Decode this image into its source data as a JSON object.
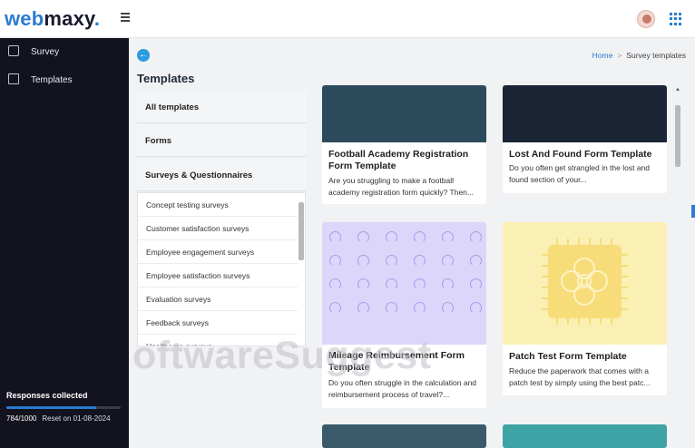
{
  "brand": {
    "web": "web",
    "maxy": "maxy",
    "dot": "."
  },
  "sidebar": {
    "items": [
      {
        "label": "Survey",
        "icon": "survey-icon"
      },
      {
        "label": "Templates",
        "icon": "templates-icon"
      }
    ],
    "responses": {
      "title": "Responses collected",
      "count": "784/1000",
      "reset": "Reset on 01-08-2024",
      "progress": 0.784
    }
  },
  "header": {
    "menu_icon": "hamburger-icon",
    "apps_icon": "grid-apps-icon",
    "avatar": "user-avatar"
  },
  "main": {
    "title": "Templates",
    "breadcrumb": {
      "home": "Home",
      "separator": ">",
      "current": "Survey templates"
    }
  },
  "categories": {
    "heads": [
      "All templates",
      "Forms",
      "Surveys & Questionnaires"
    ],
    "items": [
      "Concept testing surveys",
      "Customer satisfaction surveys",
      "Employee engagement surveys",
      "Employee satisfaction surveys",
      "Evaluation surveys",
      "Feedback surveys",
      "Healthcare surveys"
    ]
  },
  "cards": [
    {
      "title": "Football Academy Registration Form Template",
      "desc": "Are you struggling to make a football academy registration form quickly? Then...",
      "color": "#2c4a5c"
    },
    {
      "title": "Lost And Found Form Template",
      "desc": "Do you often get strangled in the lost and found section of your...",
      "color": "#1b2535"
    },
    {
      "title": "Mileage Reimbursement Form Template",
      "desc": "Do you often struggle in the calculation and reimbursement process of travel?...",
      "color": "#dcd6fb"
    },
    {
      "title": "Patch Test Form Template",
      "desc": "Reduce the paperwork that comes with a patch test by simply using the best patc...",
      "color": "#fbf0b3"
    }
  ],
  "watermark": "oftwareSuggest",
  "colors": {
    "accent": "#2a7bd1",
    "sidebar": "#13131f"
  }
}
